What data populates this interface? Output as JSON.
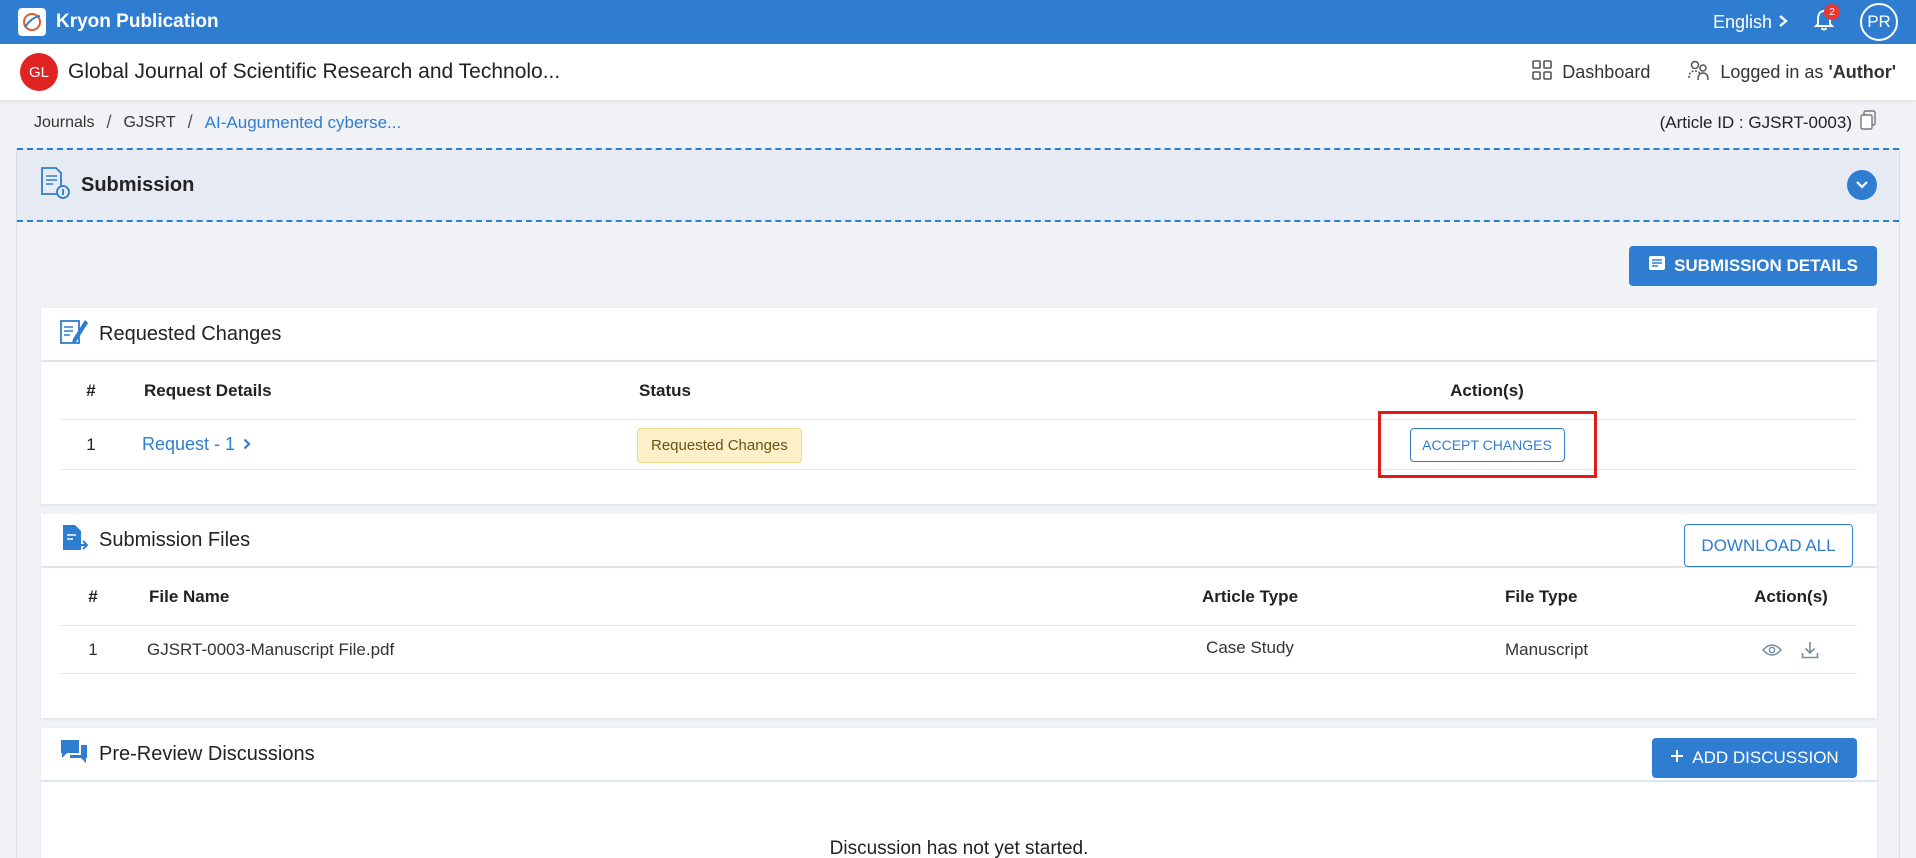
{
  "app": {
    "name": "Kryon Publication"
  },
  "topbar": {
    "language": "English",
    "notification_count": "2",
    "avatar_initials": "PR"
  },
  "journal": {
    "badge": "GL",
    "title": "Global Journal of Scientific Research and Technolo...",
    "dashboard_label": "Dashboard",
    "logged_in_prefix": "Logged in as",
    "logged_in_role": "'Author'"
  },
  "breadcrumb": {
    "items": [
      "Journals",
      "GJSRT"
    ],
    "current": "AI-Augumented cyberse...",
    "separator": "/"
  },
  "article_id": "(Article ID : GJSRT-0003)",
  "submission": {
    "title": "Submission",
    "details_button": "SUBMISSION DETAILS"
  },
  "requested_changes": {
    "title": "Requested Changes",
    "headers": [
      "#",
      "Request Details",
      "Status",
      "Action(s)"
    ],
    "rows": [
      {
        "num": "1",
        "details": "Request - 1",
        "status": "Requested Changes",
        "action": "ACCEPT CHANGES"
      }
    ]
  },
  "submission_files": {
    "title": "Submission Files",
    "download_all": "DOWNLOAD ALL",
    "headers": [
      "#",
      "File Name",
      "Article Type",
      "File Type",
      "Action(s)"
    ],
    "rows": [
      {
        "num": "1",
        "file_name": "GJSRT-0003-Manuscript File.pdf",
        "article_type": "Case Study",
        "file_type": "Manuscript"
      }
    ]
  },
  "discussions": {
    "title": "Pre-Review Discussions",
    "add_button": "ADD DISCUSSION",
    "empty_message": "Discussion has not yet started."
  },
  "colors": {
    "primary": "#2f7dd1",
    "highlight": "#e01b1b",
    "status_bg": "#fdf0c8",
    "badge_red": "#e02424"
  }
}
